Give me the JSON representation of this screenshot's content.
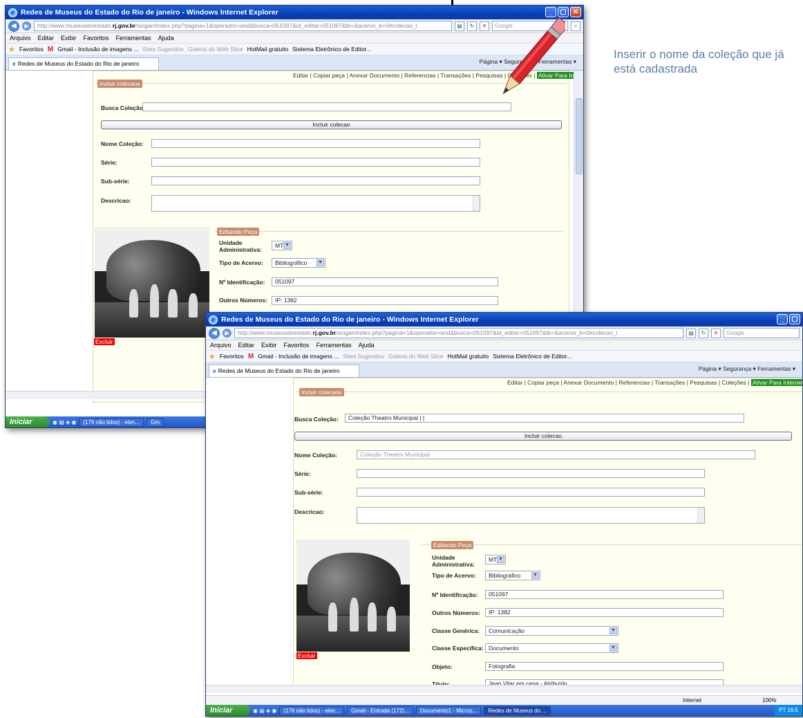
{
  "annotation": {
    "text": "Inserir o nome da coleção que já está cadastrada"
  },
  "browser": {
    "title": "Redes de Museus do Estado do Rio de janeiro - Windows Internet Explorer",
    "url_gray_prefix": "http://www.museusdoestado.",
    "url_domain": "rj.gov.br",
    "url_rest": "/siogan/index.php?pagina=1&operador=and&busca=051097&id_editar=051097&tb=&acervo_b=0#colecao_i",
    "search_placeholder": "Google",
    "menu": [
      "Arquivo",
      "Editar",
      "Exibir",
      "Favoritos",
      "Ferramentas",
      "Ajuda"
    ],
    "favorites": [
      "Favoritos",
      "Gmail - Inclusão de imagens ...",
      "Sites Sugeridos",
      "Galeria do Web Slice",
      "HotMail gratuito",
      "Sistema Eletrônico de Editor..."
    ],
    "tab_title": "Redes de Museus do Estado do Rio de janeiro",
    "commands": "Página ▾  Segurança ▾  Ferramentas ▾",
    "status_zone": "Internet",
    "zoom": "100%"
  },
  "page": {
    "toplinks": "Editar | Copiar peça | Anexar Documento | Referencias | Transações | Pesquisas | Coleções |",
    "ativar": "Ativar Para Internet",
    "incluir_title": "Incluir colecaos",
    "busca_label": "Busca Coleção:",
    "incluir_button": "Incluir colecao",
    "nome_label": "Nome Coleção:",
    "serie_label": "Série:",
    "subserie_label": "Sub-série:",
    "descricao_label": "Descricao:",
    "editando_title": "Editando Peça",
    "unidade_label": "Unidade Administrativa:",
    "unidade_value": "MT",
    "tipo_label": "Tipo de Acervo:",
    "tipo_value": "Bibliográfico",
    "ident_label": "Nº Identificação:",
    "ident_value": "051097",
    "outros_label": "Outros Números:",
    "outros_value": "IP: 1382",
    "classe_gen_label": "Classe Genérica:",
    "classe_gen_value": "Comunicação",
    "classe_esp_label": "Classe Específica:",
    "classe_esp_value": "Documento",
    "objeto_label": "Objeto:",
    "objeto_value": "Fotografia",
    "titulo_label": "Título:",
    "titulo_value": "Jean Vilar em cena - Atribuído",
    "excluir": "Excluir"
  },
  "window2_values": {
    "busca_value": "Coleção Theatro Municipal |  |",
    "nome_value": "Coleção Theatro Municipal"
  },
  "taskbar": {
    "start": "Iniciar",
    "tasks1": [
      "(176 não lidos) - elen...",
      "Gm"
    ],
    "tasks2": [
      "(176 não lidos) - elen...",
      "Gmail - Entrada (172)...",
      "Documento1 - Micros...",
      "Redes de Museus do ..."
    ],
    "tray": "PT  16:5"
  }
}
